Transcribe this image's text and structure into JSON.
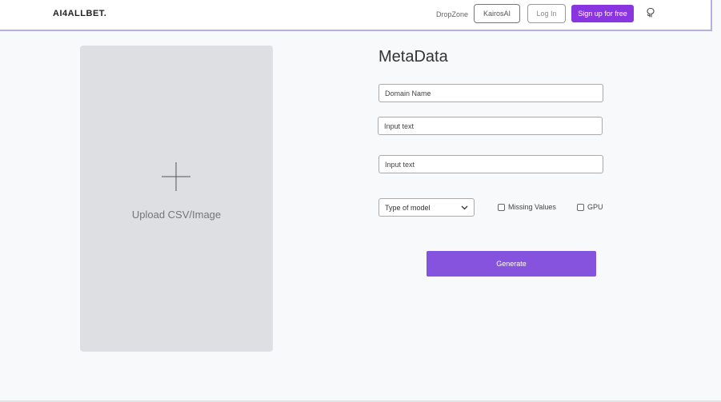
{
  "header": {
    "logo": "AI4ALLBET.",
    "nav_link": "DropZone",
    "kairos_label": "KairosAI",
    "login_label": "Log In",
    "signup_label": "Sign up for free",
    "github_icon": "github-icon"
  },
  "upload": {
    "label": "Upload CSV/Image",
    "icon": "plus-icon"
  },
  "metadata": {
    "title": "MetaData",
    "domain_placeholder": "Domain Name",
    "input1_placeholder": "Input text",
    "input2_placeholder": "Input text",
    "model_select": "Type of model",
    "missing_values_label": "Missing Values",
    "gpu_label": "GPU",
    "generate_label": "Generate"
  },
  "colors": {
    "accent": "#8a36e0",
    "generate": "#8553dd",
    "upload_panel": "#dedfe3",
    "background": "#f8f9fb"
  }
}
